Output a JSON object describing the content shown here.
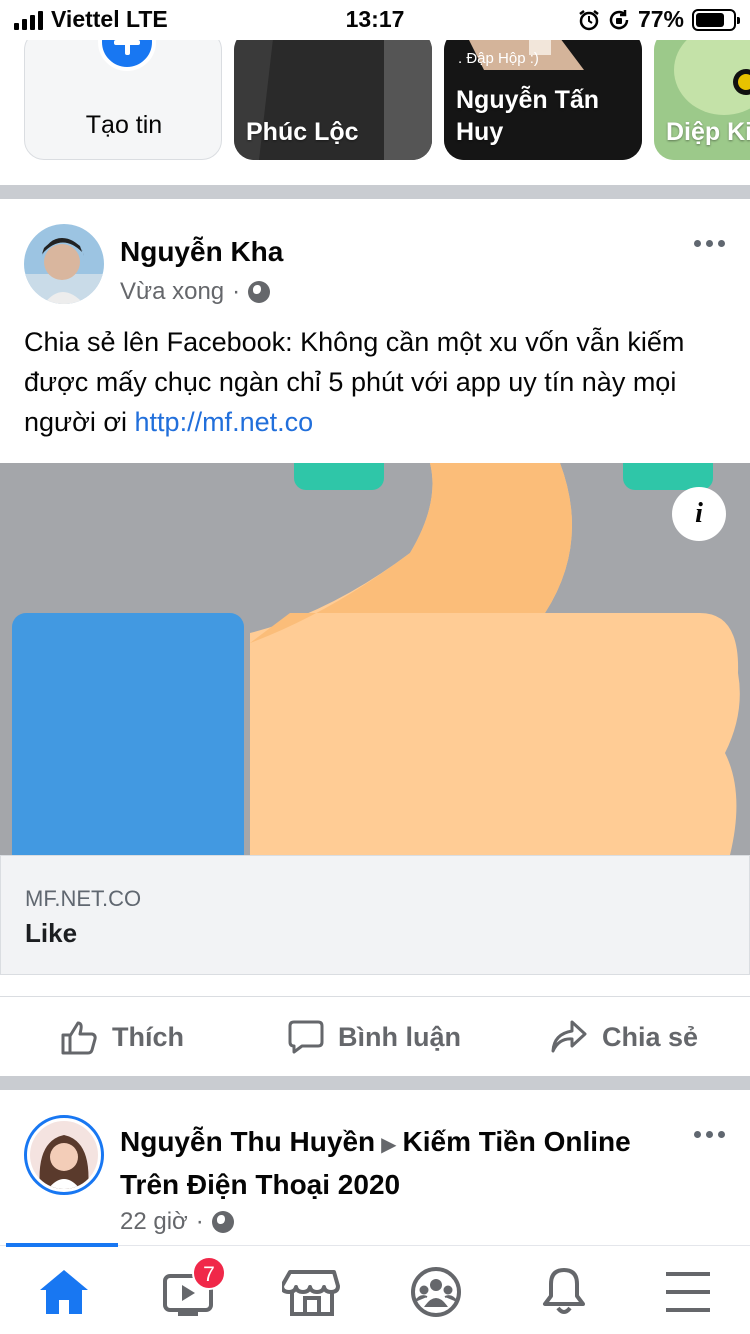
{
  "status_bar": {
    "carrier": "Viettel LTE",
    "time": "13:17",
    "battery": "77%",
    "battery_level": 0.77
  },
  "stories": [
    {
      "label": "Tạo tin",
      "type": "create"
    },
    {
      "label": "Phúc Lộc"
    },
    {
      "label": "Nguyễn Tấn Huy",
      "overlay_text": ". Đập Hộp :)"
    },
    {
      "label": "Diệp Ki"
    }
  ],
  "post1": {
    "author": "Nguyễn Kha",
    "time": "Vừa xong",
    "separator": "·",
    "text": "Chia sẻ lên Facebook: Không cần một xu vốn vẫn kiếm được mấy chục ngàn chỉ 5 phút với app uy tín này mọi người ơi ",
    "link": "http://mf.net.co",
    "info_icon": "i",
    "link_domain": "MF.NET.CO",
    "link_title": "Like"
  },
  "actions": {
    "like": "Thích",
    "comment": "Bình luận",
    "share": "Chia sẻ"
  },
  "post2": {
    "author": "Nguyễn Thu Huyền",
    "arrow": "▶",
    "group": "Kiếm Tiền Online Trên Điện Thoại 2020",
    "time": "22 giờ",
    "separator": "·"
  },
  "bottom_nav": {
    "video_badge": "7",
    "items": [
      "home-icon",
      "video-icon",
      "marketplace-icon",
      "groups-icon",
      "notifications-icon",
      "menu-icon"
    ]
  },
  "colors": {
    "accent": "#1877f2",
    "badge": "#f02849",
    "link": "#216fdb",
    "divider": "#c9ccd1"
  }
}
